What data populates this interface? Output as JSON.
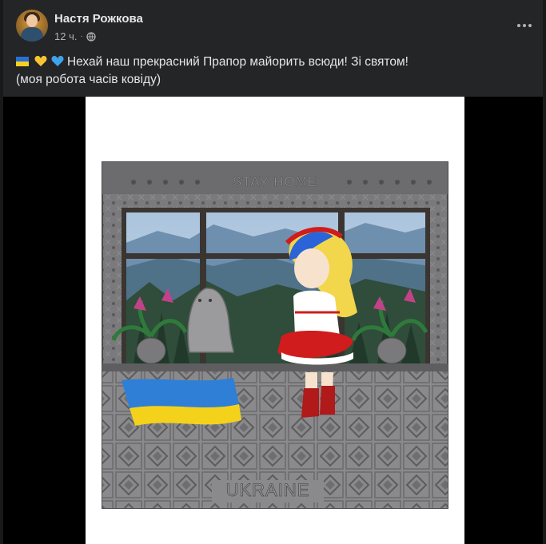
{
  "post": {
    "author": "Настя Рожкова",
    "time": "12 ч.",
    "separator": "·",
    "privacy_icon": "globe-icon",
    "more_icon": "more-horizontal-icon",
    "text_line1": "Нехай наш прекрасний Прапор майорить всюди! Зі святом!",
    "text_line2": "(моя робота часів ковіду)",
    "emoji": [
      "ukraine-flag-emoji",
      "yellow-heart-emoji",
      "blue-heart-emoji"
    ]
  },
  "artwork": {
    "top_inscription": "STAY HOME",
    "bottom_inscription": "UKRAINE",
    "colors": {
      "flag_blue": "#2f7fd6",
      "flag_yellow": "#f4d21c",
      "frame": "#6e6e70",
      "shirt_red": "#d01c1c"
    }
  },
  "colors": {
    "background": "#18191a",
    "card": "#242526",
    "text": "#e4e6eb",
    "secondary": "#b0b3b8"
  }
}
